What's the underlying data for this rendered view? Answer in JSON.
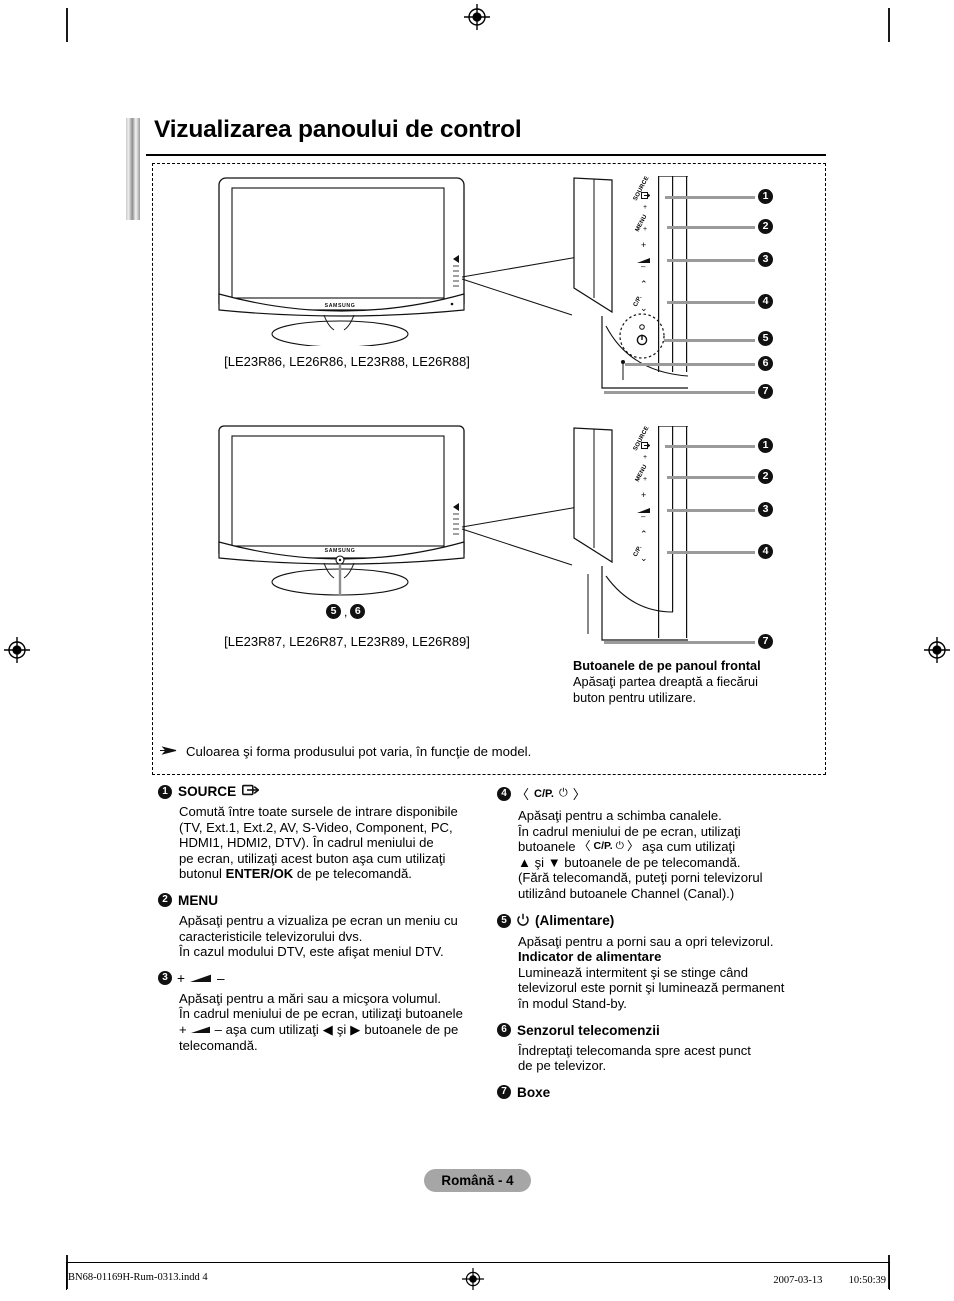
{
  "page": {
    "title": "Vizualizarea panoului de control",
    "footer_pill": "Română - 4"
  },
  "illustration": {
    "tv_top_caption": "[LE23R86, LE26R86, LE23R88, LE26R88]",
    "tv_bottom_caption": "[LE23R87, LE26R87, LE23R89, LE26R89]",
    "tv_brand": "SAMSUNG",
    "bottom_tv_marker": ",",
    "panel_labels": {
      "source": "SOURCE",
      "menu": "MENU",
      "plus": "+",
      "minus": "–",
      "channel": "C/P.",
      "up": "⌃",
      "down": "⌄"
    },
    "callouts_top": [
      "1",
      "2",
      "3",
      "4",
      "5",
      "6",
      "7"
    ],
    "callouts_bottom": [
      "1",
      "2",
      "3",
      "4",
      "7"
    ],
    "front_caption_head": "Butoanele de pe panoul frontal",
    "front_caption_body_line1": "Apăsaţi partea dreaptă a fiecărui",
    "front_caption_body_line2": "buton pentru utilizare.",
    "note": "Culoarea şi forma produsului pot varia, în funcţie de model."
  },
  "items": {
    "source": {
      "num": "1",
      "label": "SOURCE",
      "icon": "source-input-icon",
      "body_1": "Comută între toate sursele de intrare disponibile",
      "body_2": "(TV, Ext.1, Ext.2, AV, S-Video, Component, PC,",
      "body_3": "HDMI1, HDMI2, DTV). În cadrul meniului de",
      "body_4": "pe ecran, utilizaţi acest buton aşa cum utilizaţi",
      "body_5_pre": "butonul ",
      "body_5_bold": "ENTER/OK",
      "body_5_post": " de pe telecomandă."
    },
    "menu": {
      "num": "2",
      "label": "MENU",
      "body_1": "Apăsaţi pentru a vizualiza pe ecran un meniu cu",
      "body_2": "caracteristicile televizorului dvs.",
      "body_3": "În cazul modului DTV, este afişat meniul DTV."
    },
    "volume": {
      "num": "3",
      "label_plus": "+",
      "label_minus": "–",
      "icon": "volume-wedge-icon",
      "body_1": "Apăsaţi pentru a mări sau a micşora volumul.",
      "body_2": "În cadrul meniului de pe ecran, utilizaţi butoanele",
      "body_3_pre": "+",
      "body_3_mid": "–   aşa cum utilizaţi ",
      "body_3_left_arrow": "◀",
      "body_3_and": " şi ",
      "body_3_right_arrow": "▶",
      "body_3_post": " butoanele de pe",
      "body_4": "telecomandă."
    },
    "channel": {
      "num": "4",
      "label": "C/P.",
      "bracket_left": "〈",
      "bracket_right": "〉",
      "power_glyph": "⏻",
      "body_1": "Apăsaţi pentru a schimba canalele.",
      "body_2": "În cadrul meniului de pe ecran, utilizaţi",
      "body_3_pre": "butoanele ",
      "body_3_post": "  aşa cum utilizaţi",
      "body_4_up": "▲",
      "body_4_and": " şi ",
      "body_4_down": "▼",
      "body_4_post": " butoanele de pe telecomandă.",
      "body_5": "(Fără telecomandă, puteţi porni televizorul",
      "body_6": "utilizând butoanele Channel (Canal).)"
    },
    "power": {
      "num": "5",
      "label": "(Alimentare)",
      "icon": "power-icon",
      "body_1": "Apăsaţi pentru a porni sau a opri televizorul.",
      "sub_head": "Indicator de alimentare",
      "body_2": "Luminează intermitent şi se stinge când",
      "body_3": "televizorul este pornit şi luminează permanent",
      "body_4": "în modul Stand-by."
    },
    "sensor": {
      "num": "6",
      "label": "Senzorul telecomenzii",
      "body_1": "Îndreptaţi telecomanda spre acest punct",
      "body_2": "de pe televizor."
    },
    "speakers": {
      "num": "7",
      "label": "Boxe"
    }
  },
  "print_footer": {
    "left": "BN68-01169H-Rum-0313.indd   4",
    "right": "2007-03-13   　　 10:50:39"
  }
}
